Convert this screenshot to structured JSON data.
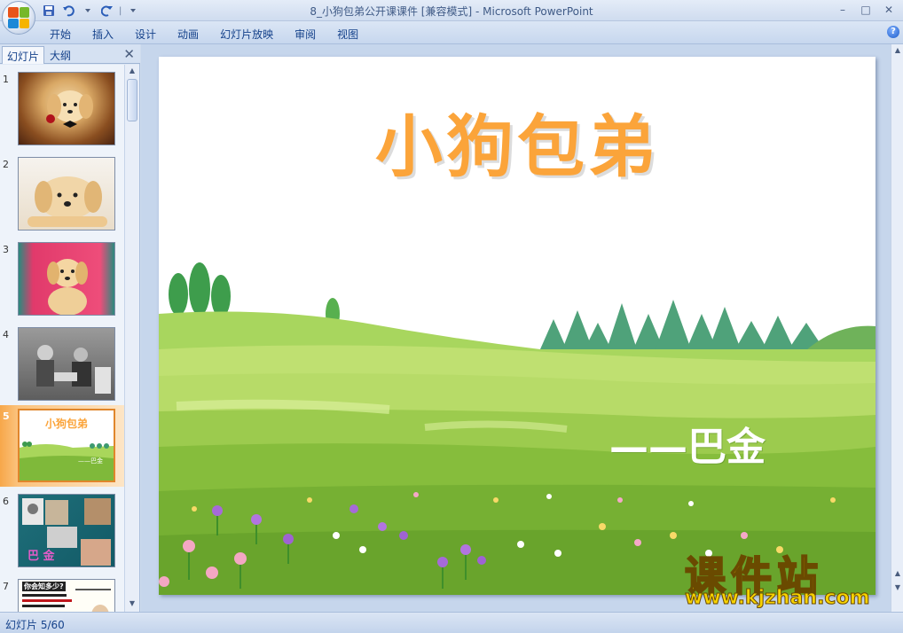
{
  "window": {
    "title_doc": "8_小狗包弟公开课课件 [兼容模式]",
    "title_sep": " - ",
    "title_app": "Microsoft PowerPoint",
    "minimize": "–",
    "maximize": "□",
    "close": "✕"
  },
  "quick_access": {
    "separator": "|"
  },
  "ribbon": {
    "tabs": [
      "开始",
      "插入",
      "设计",
      "动画",
      "幻灯片放映",
      "审阅",
      "视图"
    ],
    "help": "?"
  },
  "left_panel": {
    "tab_slides": "幻灯片",
    "tab_outline": "大纲",
    "close": "✕",
    "thumbnails": [
      {
        "num": "1",
        "selected": false
      },
      {
        "num": "2",
        "selected": false
      },
      {
        "num": "3",
        "selected": false
      },
      {
        "num": "4",
        "selected": false
      },
      {
        "num": "5",
        "selected": true,
        "title": "小狗包弟",
        "author": "——巴金"
      },
      {
        "num": "6",
        "selected": false,
        "caption": "巴  金"
      },
      {
        "num": "7",
        "selected": false,
        "caption": "你会知多少?"
      }
    ]
  },
  "slide": {
    "title": "小狗包弟",
    "author": "——巴金"
  },
  "watermark": {
    "name": "课件站",
    "url": "www.kjzhan.com"
  },
  "status_bar": {
    "slide_info": "幻灯片 5/60"
  },
  "colors": {
    "title_orange": "#fba43a",
    "selection_orange": "#f7a74a",
    "ribbon_text": "#15428b",
    "watermark_yellow": "#f7d300"
  }
}
